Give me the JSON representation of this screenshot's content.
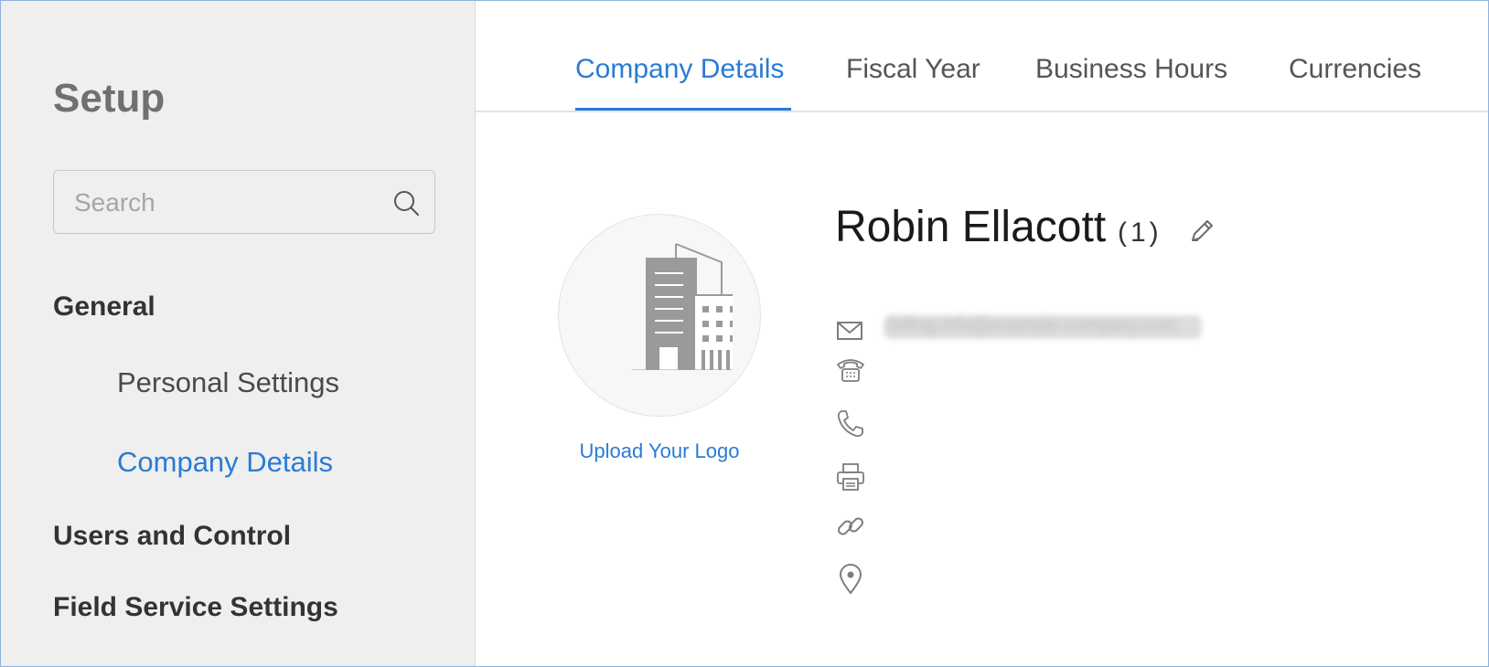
{
  "sidebar": {
    "title": "Setup",
    "search": {
      "placeholder": "Search",
      "value": ""
    },
    "groups": [
      {
        "label": "General",
        "items": [
          {
            "label": "Personal Settings",
            "active": false
          },
          {
            "label": "Company Details",
            "active": true
          }
        ]
      },
      {
        "label": "Users and Control",
        "items": []
      },
      {
        "label": "Field Service Settings",
        "items": []
      }
    ]
  },
  "tabs": [
    {
      "label": "Company Details",
      "active": true
    },
    {
      "label": "Fiscal Year",
      "active": false
    },
    {
      "label": "Business Hours",
      "active": false
    },
    {
      "label": "Currencies",
      "active": false
    }
  ],
  "company": {
    "name": "Robin Ellacott",
    "count": "(1)",
    "upload_logo_label": "Upload Your Logo",
    "email_blurred": "billing.info@example-company.com"
  },
  "icons": {
    "search": "search-icon",
    "edit": "pencil-icon",
    "email": "envelope-icon",
    "landline": "telephone-icon",
    "mobile": "phone-icon",
    "fax": "printer-icon",
    "website": "link-icon",
    "address": "location-pin-icon",
    "logo_placeholder": "building-icon"
  },
  "colors": {
    "accent": "#2a7bd4",
    "sidebar_bg": "#efefef",
    "icon_gray": "#8a8a8a"
  }
}
